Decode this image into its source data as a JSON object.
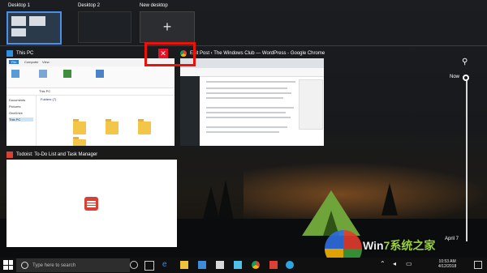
{
  "desktops": [
    {
      "label": "Desktop 1"
    },
    {
      "label": "Desktop 2"
    },
    {
      "label": "New desktop",
      "icon": "+"
    }
  ],
  "windows": {
    "this_pc": {
      "title": "This PC",
      "tabs": [
        "File",
        "Computer",
        "View"
      ],
      "address": "This PC",
      "folders_header": "Folders (7)",
      "sidebar": [
        "Documents",
        "Pictures",
        "OneDrive",
        "This PC"
      ]
    },
    "chrome": {
      "title": "Edit Post ‹ The Windows Club — WordPress - Google Chrome",
      "close_symbol": "✕"
    },
    "todoist": {
      "title": "Todoist: To-Do List and Task Manager"
    }
  },
  "timeline": {
    "now_label": "Now",
    "date_label": "April 7"
  },
  "taskbar": {
    "search_placeholder": "Type here to search",
    "time": "10:53 AM",
    "date": "4/12/2018"
  },
  "watermark": {
    "text_a": "Win",
    "text_b": "7系统之家"
  }
}
